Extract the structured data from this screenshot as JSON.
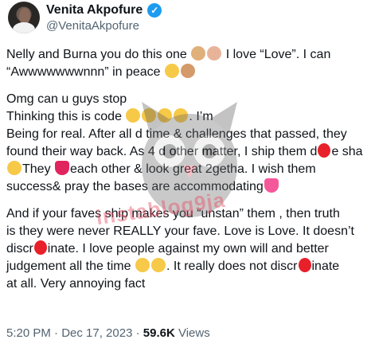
{
  "author": {
    "name": "Venita Akpofure",
    "handle": "@VenitaAkpofure"
  },
  "tweet": {
    "p1_l1_a": "Nelly and Burna you do this one",
    "p1_l1_b": "I love “Love”. I can",
    "p1_l2": "“Awwwwwwwnnn” in peace",
    "p2_l1": "Omg can u guys stop",
    "p2_l2_a": "Thinking this is code",
    "p2_l2_b": ". I’m",
    "p2_l3": "Being for real. After all d time & challenges that passed, they",
    "p2_l4": "found their way back. As 4 d other matter, I ship them d",
    "p2_l4_b": "e sha",
    "p2_l5_a": "They",
    "p2_l5_b": "each other & look great 2getha. I wish them",
    "p2_l6": "success& pray the bases are accommodating",
    "p3_l1": "And if your faves ship makes you “unstan” them , then truth",
    "p3_l2": "is they were never REALLY your fave. Love is Love. It doesn’t",
    "p3_l3_a": "discr",
    "p3_l3_b": "inate. I love people against my own will and better",
    "p3_l4_a": "judgement all the time",
    "p3_l4_b": ". It really does not discr",
    "p3_l4_c": "inate",
    "p3_l5": "at all. Very annoying fact"
  },
  "meta": {
    "time": "5:20 PM · Dec 17, 2023 · ",
    "views_count": "59.6K",
    "views_label": " Views"
  },
  "watermark": {
    "text": "instablog9ja"
  },
  "icons": {
    "verified": "verified-badge-icon",
    "emojis": [
      "clapping-hands",
      "heart-hands",
      "hugging-face",
      "raising-hands",
      "face-with-tears-of-joy",
      "rofl",
      "blushing-face",
      "red-heart",
      "sparkling-heart"
    ]
  },
  "colors": {
    "verified": "#1d9bf0",
    "text": "#0f1419",
    "secondary": "#536471",
    "redaction": "#e8202a"
  }
}
